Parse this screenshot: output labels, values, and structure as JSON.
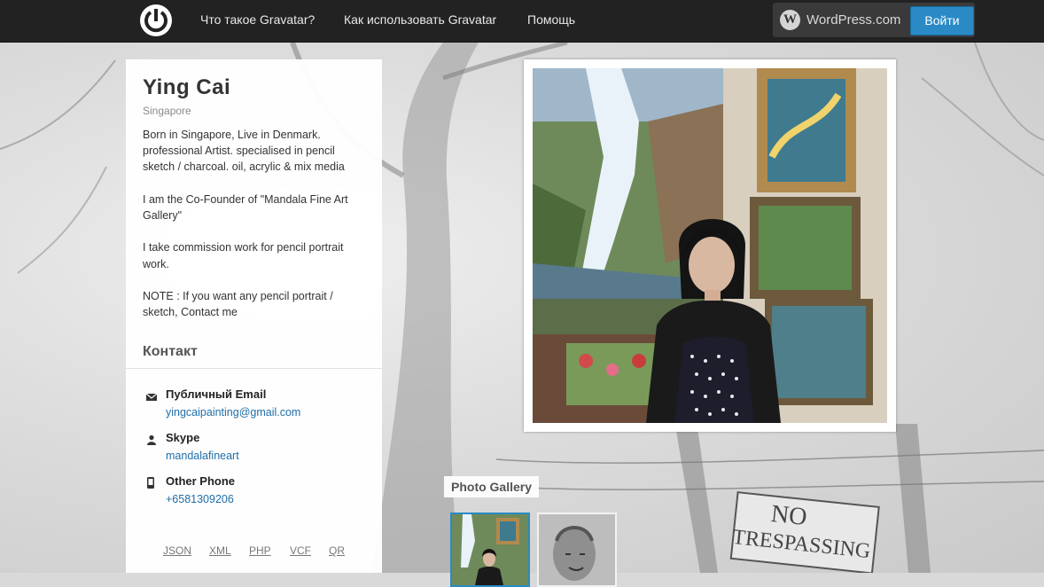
{
  "nav": {
    "links": [
      "Что такое Gravatar?",
      "Как использовать Gravatar",
      "Помощь"
    ],
    "wordpress_label": "WordPress.com",
    "login_label": "Войти"
  },
  "profile": {
    "name": "Ying Cai",
    "location": "Singapore",
    "about": [
      "Born in Singapore, Live in Denmark. professional Artist. specialised in pencil sketch / charcoal. oil, acrylic & mix media",
      "I am the Co-Founder of \"Mandala Fine Art Gallery\"",
      "I take commission work for pencil portrait work.",
      "NOTE : If you want any pencil portrait / sketch, Contact me"
    ]
  },
  "contact": {
    "title": "Контакт",
    "items": [
      {
        "label": "Публичный Email",
        "value": "yingcaipainting@gmail.com",
        "icon": "envelope-icon"
      },
      {
        "label": "Skype",
        "value": "mandalafineart",
        "icon": "person-icon"
      },
      {
        "label": "Other Phone",
        "value": "+6581309206",
        "icon": "phone-icon"
      }
    ]
  },
  "formats": [
    "JSON",
    "XML",
    "PHP",
    "VCF",
    "QR"
  ],
  "gallery": {
    "title": "Photo Gallery"
  },
  "sign_text": [
    "NO",
    "TRESPASSING"
  ],
  "colors": {
    "topbar": "#222222",
    "accent": "#2a8ac5",
    "link": "#1e6ea8"
  }
}
